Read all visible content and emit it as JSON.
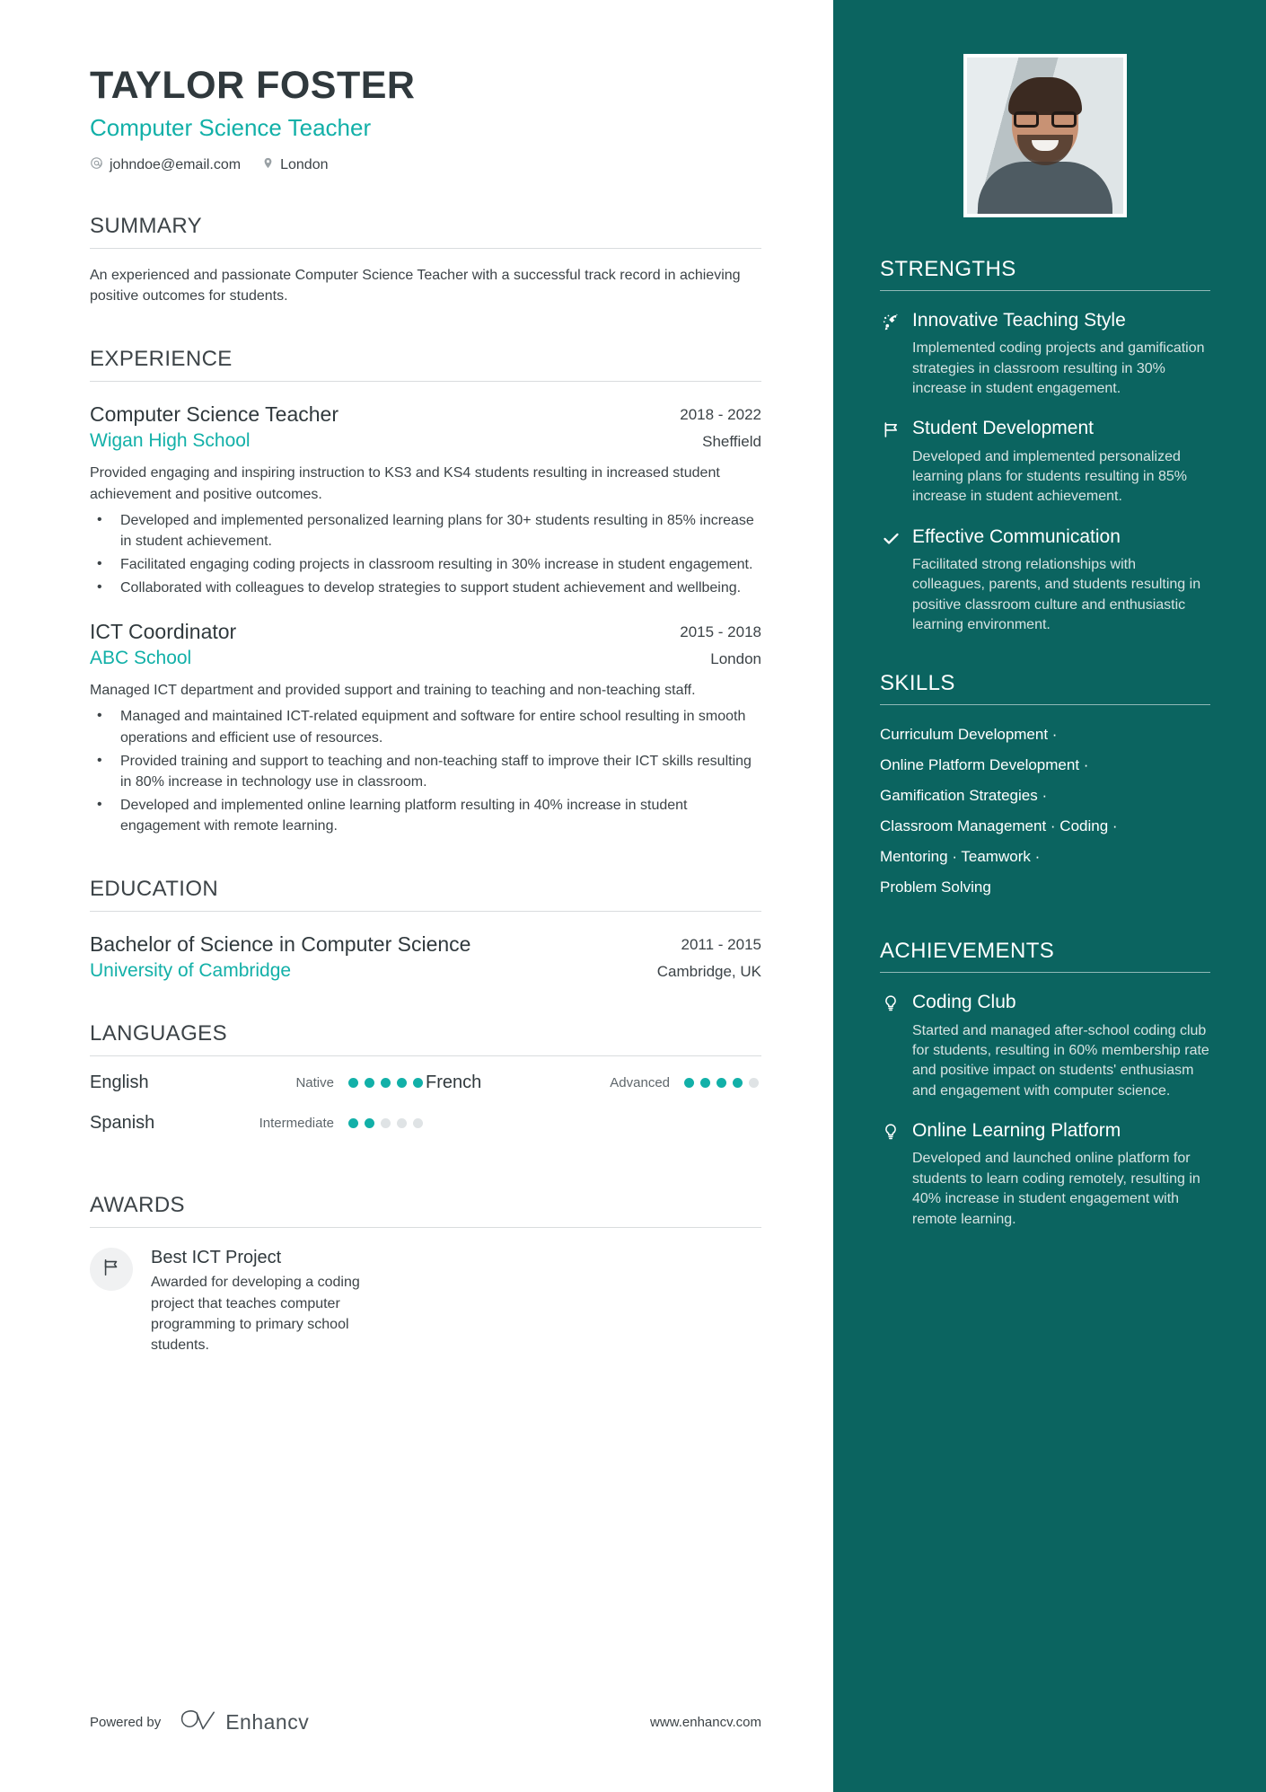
{
  "header": {
    "name": "TAYLOR FOSTER",
    "job_title": "Computer Science Teacher",
    "email": "johndoe@email.com",
    "location": "London"
  },
  "summary": {
    "title": "SUMMARY",
    "text": "An experienced and passionate Computer Science Teacher with a successful track record in achieving positive outcomes for students."
  },
  "experience": {
    "title": "EXPERIENCE",
    "entries": [
      {
        "role": "Computer Science Teacher",
        "dates": "2018 - 2022",
        "organization": "Wigan High School",
        "location": "Sheffield",
        "description": "Provided engaging and inspiring instruction to KS3 and KS4 students resulting in increased student achievement and positive outcomes.",
        "bullets": [
          "Developed and implemented personalized learning plans for 30+ students resulting in 85% increase in student achievement.",
          "Facilitated engaging coding projects in classroom resulting in 30% increase in student engagement.",
          "Collaborated with colleagues to develop strategies to support student achievement and wellbeing."
        ]
      },
      {
        "role": "ICT Coordinator",
        "dates": "2015 - 2018",
        "organization": "ABC School",
        "location": "London",
        "description": "Managed ICT department and provided support and training to teaching and non-teaching staff.",
        "bullets": [
          "Managed and maintained ICT-related equipment and software for entire school resulting in smooth operations and efficient use of resources.",
          "Provided training and support to teaching and non-teaching staff to improve their ICT skills resulting in 80% increase in technology use in classroom.",
          "Developed and implemented online learning platform resulting in 40% increase in student engagement with remote learning."
        ]
      }
    ]
  },
  "education": {
    "title": "EDUCATION",
    "entries": [
      {
        "degree": "Bachelor of Science in Computer Science",
        "dates": "2011 - 2015",
        "organization": "University of Cambridge",
        "location": "Cambridge, UK"
      }
    ]
  },
  "languages": {
    "title": "LANGUAGES",
    "items": [
      {
        "name": "English",
        "level": "Native",
        "filled": 5,
        "total": 5
      },
      {
        "name": "French",
        "level": "Advanced",
        "filled": 4,
        "total": 5
      },
      {
        "name": "Spanish",
        "level": "Intermediate",
        "filled": 2,
        "total": 5
      }
    ]
  },
  "awards": {
    "title": "AWARDS",
    "items": [
      {
        "icon": "flag-icon",
        "name": "Best ICT Project",
        "description": "Awarded for developing a coding project that teaches computer programming to primary school students."
      }
    ]
  },
  "footer": {
    "powered_by": "Powered by",
    "brand": "Enhancv",
    "website": "www.enhancv.com"
  },
  "strengths": {
    "title": "STRENGTHS",
    "items": [
      {
        "icon": "rocket-icon",
        "name": "Innovative Teaching Style",
        "description": "Implemented coding projects and gamification strategies in classroom resulting in 30% increase in student engagement."
      },
      {
        "icon": "flag-icon",
        "name": "Student Development",
        "description": "Developed and implemented personalized learning plans for students resulting in 85% increase in student achievement."
      },
      {
        "icon": "check-icon",
        "name": "Effective Communication",
        "description": "Facilitated strong relationships with colleagues, parents, and students resulting in positive classroom culture and enthusiastic learning environment."
      }
    ]
  },
  "skills": {
    "title": "SKILLS",
    "lines": [
      "Curriculum Development ·",
      "Online Platform Development ·",
      "Gamification Strategies ·",
      "Classroom Management · Coding ·",
      "Mentoring · Teamwork ·",
      "Problem Solving"
    ]
  },
  "achievements": {
    "title": "ACHIEVEMENTS",
    "items": [
      {
        "icon": "lightbulb-icon",
        "name": "Coding Club",
        "description": "Started and managed after-school coding club for students, resulting in 60% membership rate and positive impact on students' enthusiasm and engagement with computer science."
      },
      {
        "icon": "lightbulb-icon",
        "name": "Online Learning Platform",
        "description": "Developed and launched online platform for students to learn coding remotely, resulting in 40% increase in student engagement with remote learning."
      }
    ]
  },
  "colors": {
    "accent": "#12b0a8",
    "sidebar": "#0b6460",
    "text": "#3c4347",
    "heading": "#30393d"
  }
}
